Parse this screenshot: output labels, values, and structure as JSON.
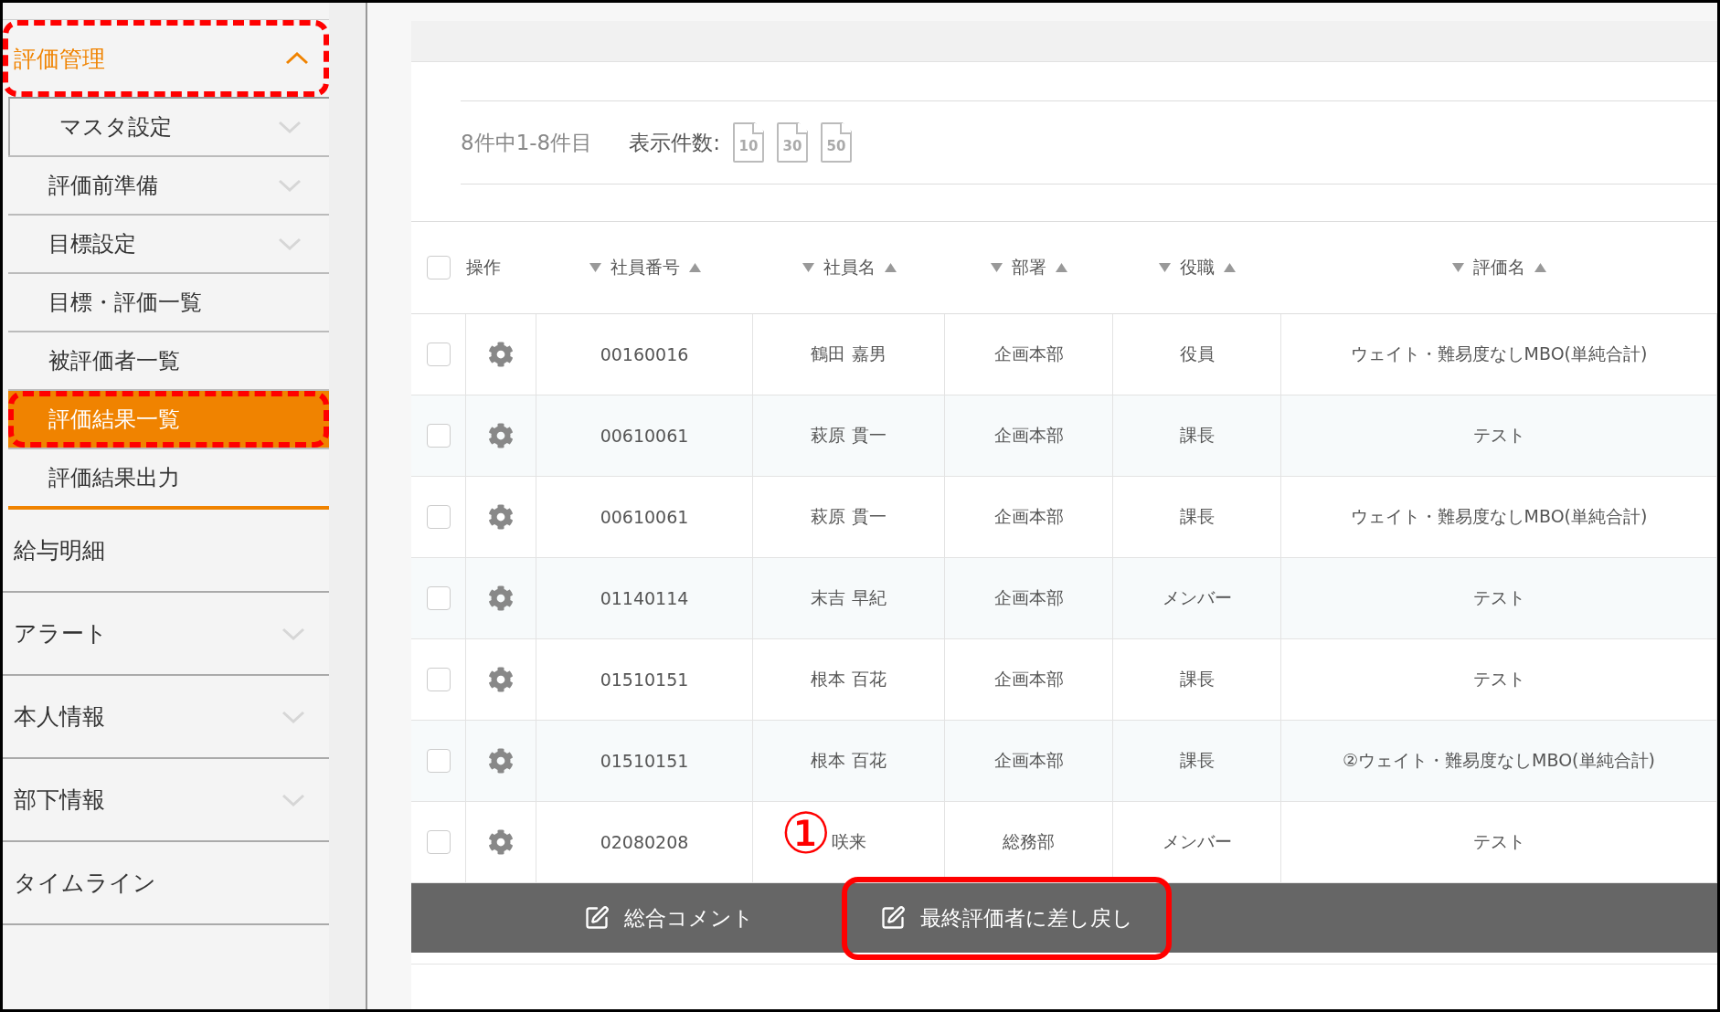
{
  "sidebar": {
    "section": {
      "label": "評価管理",
      "expanded": true,
      "marked": true
    },
    "sub_items": [
      {
        "label": "マスタ設定",
        "has_children": true,
        "selected": false,
        "marked": false
      },
      {
        "label": "評価前準備",
        "has_children": true,
        "selected": false,
        "marked": false
      },
      {
        "label": "目標設定",
        "has_children": true,
        "selected": false,
        "marked": false
      },
      {
        "label": "目標・評価一覧",
        "has_children": false,
        "selected": false,
        "marked": false
      },
      {
        "label": "被評価者一覧",
        "has_children": false,
        "selected": false,
        "marked": false
      },
      {
        "label": "評価結果一覧",
        "has_children": false,
        "selected": true,
        "marked": true
      },
      {
        "label": "評価結果出力",
        "has_children": false,
        "selected": false,
        "marked": false
      }
    ],
    "items": [
      {
        "label": "給与明細",
        "has_children": false
      },
      {
        "label": "アラート",
        "has_children": true
      },
      {
        "label": "本人情報",
        "has_children": true
      },
      {
        "label": "部下情報",
        "has_children": true
      },
      {
        "label": "タイムライン",
        "has_children": false
      }
    ]
  },
  "toolbar": {
    "count": "8件中1-8件目",
    "page_size_label": "表示件数:",
    "page_sizes": [
      "10",
      "30",
      "50"
    ]
  },
  "table": {
    "all_checked": false,
    "columns": [
      {
        "label": "操作",
        "sortable": false
      },
      {
        "label": "社員番号",
        "sortable": true
      },
      {
        "label": "社員名",
        "sortable": true
      },
      {
        "label": "部署",
        "sortable": true
      },
      {
        "label": "役職",
        "sortable": true
      },
      {
        "label": "評価名",
        "sortable": true
      }
    ],
    "rows": [
      {
        "checked": false,
        "cells": [
          "",
          "00160016",
          "鶴田 嘉男",
          "企画本部",
          "役員",
          "ウェイト・難易度なしMBO(単純合計)"
        ]
      },
      {
        "checked": false,
        "cells": [
          "",
          "00610061",
          "萩原 貫一",
          "企画本部",
          "課長",
          "テスト"
        ]
      },
      {
        "checked": false,
        "cells": [
          "",
          "00610061",
          "萩原 貫一",
          "企画本部",
          "課長",
          "ウェイト・難易度なしMBO(単純合計)"
        ]
      },
      {
        "checked": false,
        "cells": [
          "",
          "01140114",
          "末吉 早紀",
          "企画本部",
          "メンバー",
          "テスト"
        ]
      },
      {
        "checked": false,
        "cells": [
          "",
          "01510151",
          "根本 百花",
          "企画本部",
          "課長",
          "テスト"
        ]
      },
      {
        "checked": false,
        "cells": [
          "",
          "01510151",
          "根本 百花",
          "企画本部",
          "課長",
          "②ウェイト・難易度なしMBO(単純合計)"
        ]
      },
      {
        "checked": false,
        "cells": [
          "",
          "02080208",
          "咲来",
          "総務部",
          "メンバー",
          "テスト"
        ]
      }
    ]
  },
  "action_bar": {
    "buttons": [
      {
        "label": "総合コメント",
        "marked": false
      },
      {
        "label": "最終評価者に差し戻し",
        "marked": true,
        "callout": "①"
      }
    ]
  }
}
